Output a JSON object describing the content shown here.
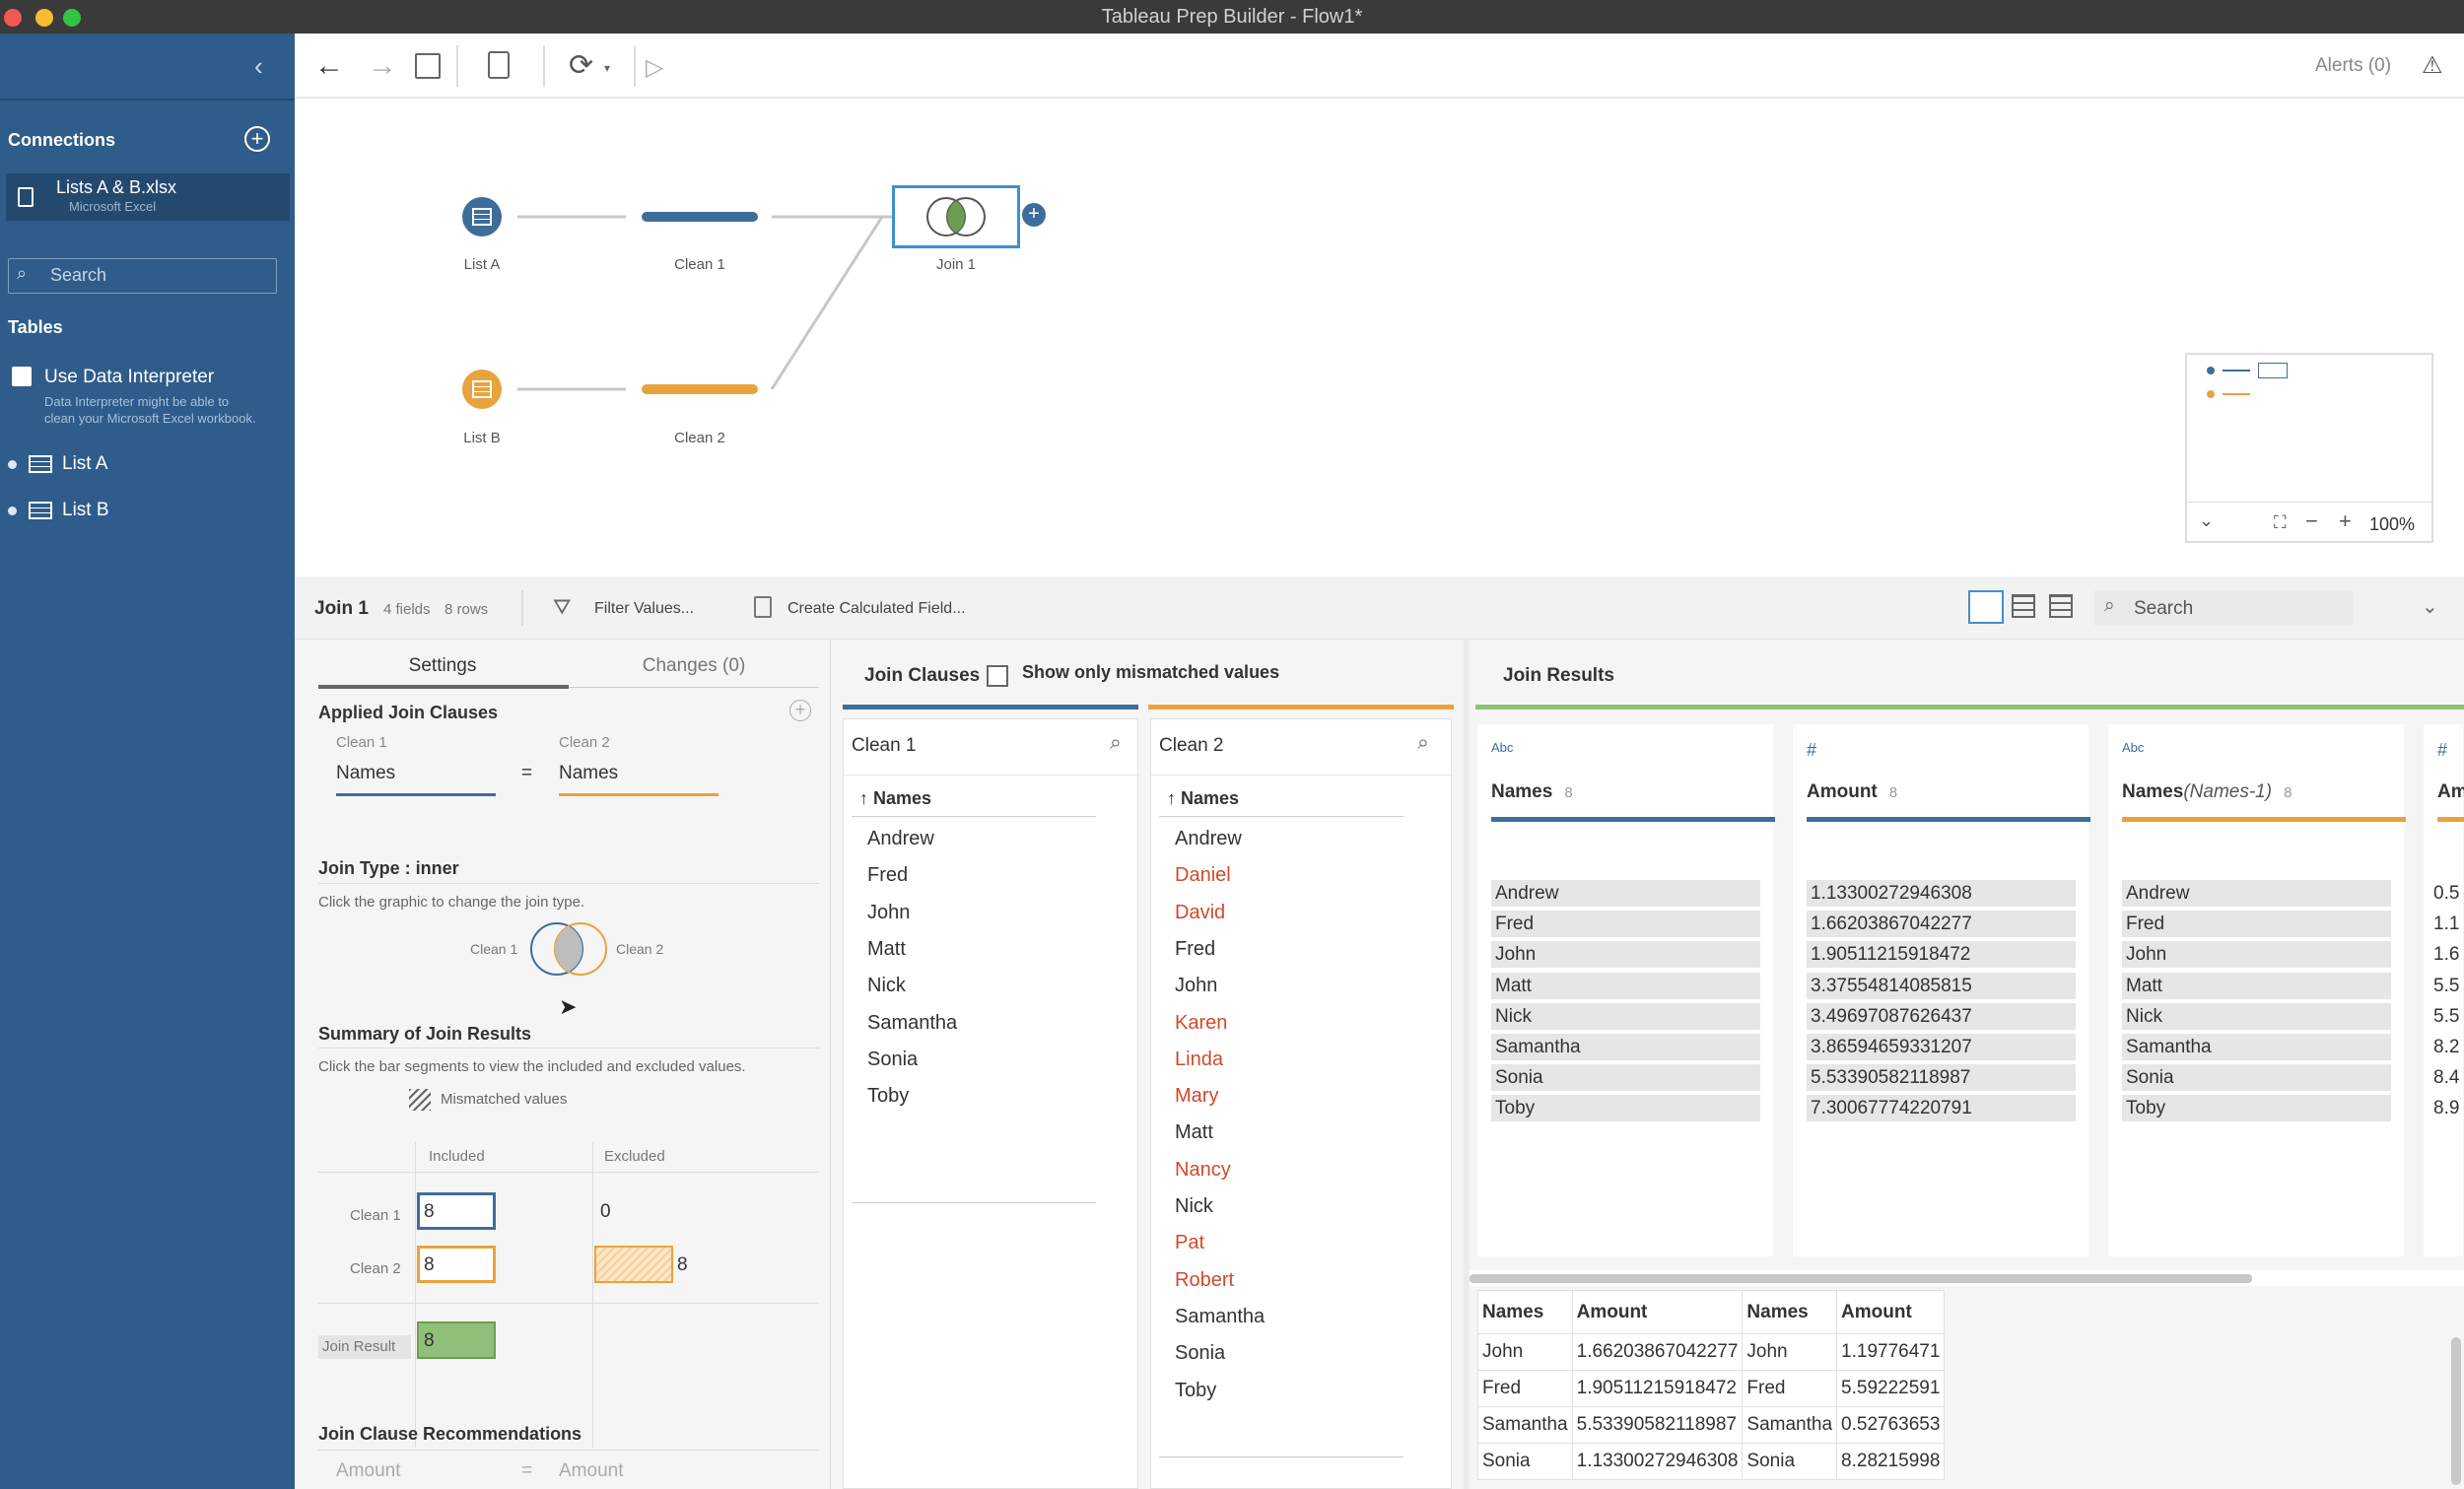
{
  "window": {
    "title": "Tableau Prep Builder - Flow1*"
  },
  "toolbar": {
    "alerts": "Alerts (0)"
  },
  "sidebar": {
    "connections_title": "Connections",
    "connection": {
      "name": "Lists A & B.xlsx",
      "type": "Microsoft Excel"
    },
    "search_placeholder": "Search",
    "tables_title": "Tables",
    "interpreter_label": "Use Data Interpreter",
    "interpreter_note_1": "Data Interpreter might be able to",
    "interpreter_note_2": "clean your Microsoft Excel workbook.",
    "tables": [
      "List A",
      "List B"
    ]
  },
  "flow": {
    "nodes": {
      "list_a": "List A",
      "clean_1": "Clean 1",
      "join_1": "Join 1",
      "list_b": "List B",
      "clean_2": "Clean 2"
    },
    "zoom": "100%"
  },
  "profile": {
    "step": "Join 1",
    "fields": "4 fields",
    "rows": "8 rows",
    "filter": "Filter Values...",
    "calc": "Create Calculated Field...",
    "search_placeholder": "Search"
  },
  "settings": {
    "tab_settings": "Settings",
    "tab_changes": "Changes (0)",
    "applied_title": "Applied Join Clauses",
    "clause_left_label": "Clean 1",
    "clause_right_label": "Clean 2",
    "clause_left_field": "Names",
    "clause_op": "=",
    "clause_right_field": "Names",
    "join_type_title": "Join Type : inner",
    "join_type_note": "Click the graphic to change the join type.",
    "venn_left": "Clean 1",
    "venn_right": "Clean 2",
    "summary_title": "Summary of Join Results",
    "summary_note": "Click the bar segments to view the included and excluded values.",
    "mismatched": "Mismatched values",
    "col_included": "Included",
    "col_excluded": "Excluded",
    "row_clean1": "Clean 1",
    "row_clean2": "Clean 2",
    "row_result": "Join Result",
    "clean1_included": "8",
    "clean1_excluded": "0",
    "clean2_included": "8",
    "clean2_excluded": "8",
    "result_included": "8",
    "recs_title": "Join Clause Recommendations",
    "rec_left": "Amount",
    "rec_op": "=",
    "rec_right": "Amount"
  },
  "clauses": {
    "title": "Join Clauses",
    "mismatch_toggle": "Show only mismatched values",
    "left_title": "Clean 1",
    "right_title": "Clean 2",
    "left_header": "Names",
    "right_header": "Names",
    "left_values": [
      "Andrew",
      "Fred",
      "John",
      "Matt",
      "Nick",
      "Samantha",
      "Sonia",
      "Toby"
    ],
    "right_values": [
      {
        "v": "Andrew",
        "mismatch": false
      },
      {
        "v": "Daniel",
        "mismatch": true
      },
      {
        "v": "David",
        "mismatch": true
      },
      {
        "v": "Fred",
        "mismatch": false
      },
      {
        "v": "John",
        "mismatch": false
      },
      {
        "v": "Karen",
        "mismatch": true
      },
      {
        "v": "Linda",
        "mismatch": true
      },
      {
        "v": "Mary",
        "mismatch": true
      },
      {
        "v": "Matt",
        "mismatch": false
      },
      {
        "v": "Nancy",
        "mismatch": true
      },
      {
        "v": "Nick",
        "mismatch": false
      },
      {
        "v": "Pat",
        "mismatch": true
      },
      {
        "v": "Robert",
        "mismatch": true
      },
      {
        "v": "Samantha",
        "mismatch": false
      },
      {
        "v": "Sonia",
        "mismatch": false
      },
      {
        "v": "Toby",
        "mismatch": false
      }
    ]
  },
  "results": {
    "title": "Join Results",
    "cards": [
      {
        "type": "Abc",
        "name": "Names",
        "alias": "",
        "count": "8",
        "color": "#3d6e99",
        "values": [
          "Andrew",
          "Fred",
          "John",
          "Matt",
          "Nick",
          "Samantha",
          "Sonia",
          "Toby"
        ]
      },
      {
        "type": "#",
        "name": "Amount",
        "alias": "",
        "count": "8",
        "color": "#3d6e99",
        "values": [
          "1.13300272946308",
          "1.66203867042277",
          "1.90511215918472",
          "3.37554814085815",
          "3.49697087626437",
          "3.86594659331207",
          "5.53390582118987",
          "7.30067774220791"
        ]
      },
      {
        "type": "Abc",
        "name": "Names",
        "alias": "(Names-1)",
        "count": "8",
        "color": "#e8a33d",
        "values": [
          "Andrew",
          "Fred",
          "John",
          "Matt",
          "Nick",
          "Samantha",
          "Sonia",
          "Toby"
        ]
      },
      {
        "type": "#",
        "name": "Am",
        "alias": "",
        "count": "",
        "color": "#e8a33d",
        "values": [
          "0.5",
          "1.1",
          "1.6",
          "5.5",
          "5.5",
          "8.2",
          "8.4",
          "8.9"
        ]
      }
    ],
    "grid": {
      "headers": [
        "Names",
        "Amount",
        "Names",
        "Amount"
      ],
      "rows": [
        [
          "John",
          "1.66203867042277",
          "John",
          "1.19776471"
        ],
        [
          "Fred",
          "1.90511215918472",
          "Fred",
          "5.59222591"
        ],
        [
          "Samantha",
          "5.53390582118987",
          "Samantha",
          "0.52763653"
        ],
        [
          "Sonia",
          "1.13300272946308",
          "Sonia",
          "8.28215998"
        ]
      ]
    }
  }
}
